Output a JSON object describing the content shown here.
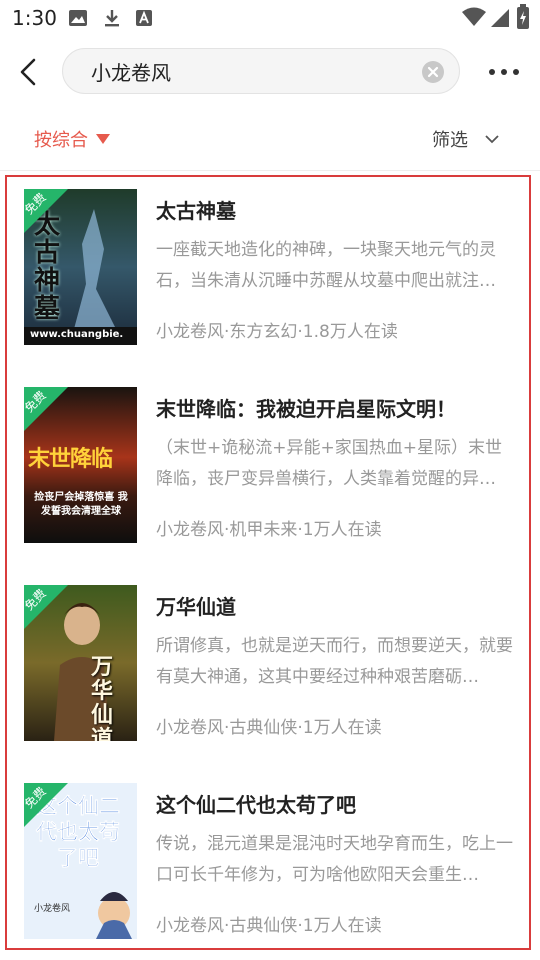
{
  "status_bar": {
    "time": "1:30"
  },
  "search": {
    "query": "小龙卷风"
  },
  "filters": {
    "sort_label": "按综合",
    "filter_label": "筛选"
  },
  "books": [
    {
      "badge": "免费",
      "title": "太古神墓",
      "desc": "一座截天地造化的神碑，一块聚天地元气的灵石，当朱清从沉睡中苏醒从坟墓中爬出就注…",
      "meta": "小龙卷风·东方玄幻·1.8万人在读",
      "cover_text": "太古神墓",
      "cover_url_text": "www.chuangbie."
    },
    {
      "badge": "免费",
      "title": "末世降临：我被迫开启星际文明！",
      "desc": "（末世+诡秘流+异能+家国热血+星际）末世降临，丧尸变异兽横行，人类靠着觉醒的异…",
      "meta": "小龙卷风·机甲未来·1万人在读",
      "cover_text": "末世降临",
      "cover_sub": "捡丧尸会掉落惊喜 我发誓我会清理全球"
    },
    {
      "badge": "免费",
      "title": "万华仙道",
      "desc": "所谓修真，也就是逆天而行，而想要逆天，就要有莫大神通，这其中要经过种种艰苦磨砺…",
      "meta": "小龙卷风·古典仙侠·1万人在读",
      "cover_text": "万华仙道"
    },
    {
      "badge": "免费",
      "title": "这个仙二代也太苟了吧",
      "desc": "传说，混元道果是混沌时天地孕育而生，吃上一口可长千年修为，可为啥他欧阳天会重生…",
      "meta": "小龙卷风·古典仙侠·1万人在读",
      "cover_text": "这个仙二代也太苟了吧",
      "cover_author": "小龙卷风"
    }
  ],
  "colors": {
    "accent": "#e65a4d",
    "badge": "#25b56a",
    "highlight_border": "#d93c3c"
  }
}
